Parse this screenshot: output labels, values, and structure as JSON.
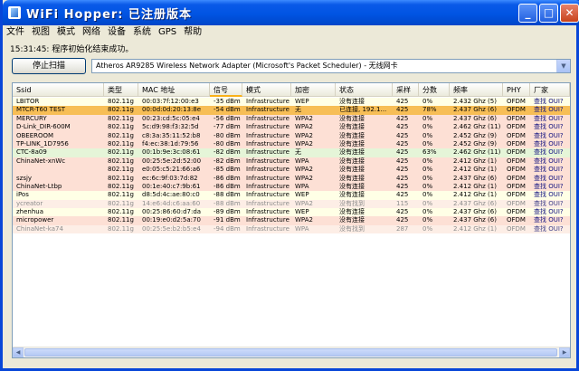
{
  "window": {
    "title": "WiFi Hopper: 已注册版本"
  },
  "menu": [
    "文件",
    "视图",
    "模式",
    "网络",
    "设备",
    "系统",
    "GPS",
    "帮助"
  ],
  "status_text": "15:31:45: 程序初始化结束成功。",
  "toolbar": {
    "stop_scan_label": "停止扫描",
    "adapter_value": "Atheros AR9285 Wireless Network Adapter (Microsoft's Packet Scheduler) - 无线网卡"
  },
  "columns": [
    "Ssid",
    "类型",
    "MAC 地址",
    "信号",
    "模式",
    "加密",
    "状态",
    "采样",
    "分数",
    "频率",
    "PHY",
    "厂家"
  ],
  "sorted_column": "信号",
  "rows": [
    {
      "bg": "#ffffe6",
      "dim": false,
      "cells": [
        "LBITOR",
        "802.11g",
        "00:03:7f:12:00:e3",
        "-35 dBm",
        "Infrastructure",
        "WEP",
        "没有连接",
        "425",
        "0%",
        "2.432 Ghz (5)",
        "OFDM",
        "查找 OUI?"
      ]
    },
    {
      "bg": "#f7be56",
      "dim": false,
      "cells": [
        "MTCR-T60 TEST",
        "802.11g",
        "00:0d:0d:20:13:8e",
        "-54 dBm",
        "Infrastructure",
        "无",
        "已连接, 192.1...",
        "425",
        "78%",
        "2.437 Ghz (6)",
        "OFDM",
        "查找 OUI?"
      ]
    },
    {
      "bg": "#fde0d5",
      "dim": false,
      "cells": [
        "MERCURY",
        "802.11g",
        "00:23:cd:5c:05:e4",
        "-56 dBm",
        "Infrastructure",
        "WPA2",
        "没有连接",
        "425",
        "0%",
        "2.437 Ghz (6)",
        "OFDM",
        "查找 OUI?"
      ]
    },
    {
      "bg": "#fde0d5",
      "dim": false,
      "cells": [
        "D-Link_DIR-600M",
        "802.11g",
        "5c:d9:98:f3:32:5d",
        "-77 dBm",
        "Infrastructure",
        "WPA2",
        "没有连接",
        "425",
        "0%",
        "2.462 Ghz (11)",
        "OFDM",
        "查找 OUI?"
      ]
    },
    {
      "bg": "#fde0d5",
      "dim": false,
      "cells": [
        "OBEEROOM",
        "802.11g",
        "c8:3a:35:11:52:b8",
        "-80 dBm",
        "Infrastructure",
        "WPA2",
        "没有连接",
        "425",
        "0%",
        "2.452 Ghz (9)",
        "OFDM",
        "查找 OUI?"
      ]
    },
    {
      "bg": "#fde0d5",
      "dim": false,
      "cells": [
        "TP-LINK_1D7956",
        "802.11g",
        "f4:ec:38:1d:79:56",
        "-80 dBm",
        "Infrastructure",
        "WPA2",
        "没有连接",
        "425",
        "0%",
        "2.452 Ghz (9)",
        "OFDM",
        "查找 OUI?"
      ]
    },
    {
      "bg": "#e5f5d8",
      "dim": false,
      "cells": [
        "CTC-8a09",
        "802.11g",
        "00:1b:9e:3c:08:61",
        "-82 dBm",
        "Infrastructure",
        "无",
        "没有连接",
        "425",
        "63%",
        "2.462 Ghz (11)",
        "OFDM",
        "查找 OUI?"
      ]
    },
    {
      "bg": "#fde0d5",
      "dim": false,
      "cells": [
        "ChinaNet-xnWc",
        "802.11g",
        "00:25:5e:2d:52:00",
        "-82 dBm",
        "Infrastructure",
        "WPA",
        "没有连接",
        "425",
        "0%",
        "2.412 Ghz (1)",
        "OFDM",
        "查找 OUI?"
      ]
    },
    {
      "bg": "#fde0d5",
      "dim": false,
      "cells": [
        "",
        "802.11g",
        "e0:05:c5:21:66:a6",
        "-85 dBm",
        "Infrastructure",
        "WPA2",
        "没有连接",
        "425",
        "0%",
        "2.412 Ghz (1)",
        "OFDM",
        "查找 OUI?"
      ]
    },
    {
      "bg": "#fde0d5",
      "dim": false,
      "cells": [
        "szsjy",
        "802.11g",
        "ec:6c:9f:03:7d:82",
        "-86 dBm",
        "Infrastructure",
        "WPA2",
        "没有连接",
        "425",
        "0%",
        "2.437 Ghz (6)",
        "OFDM",
        "查找 OUI?"
      ]
    },
    {
      "bg": "#fde0d5",
      "dim": false,
      "cells": [
        "ChinaNet-Ltbp",
        "802.11g",
        "00:1e:40:c7:9b:61",
        "-86 dBm",
        "Infrastructure",
        "WPA",
        "没有连接",
        "425",
        "0%",
        "2.412 Ghz (1)",
        "OFDM",
        "查找 OUI?"
      ]
    },
    {
      "bg": "#ffffe6",
      "dim": false,
      "cells": [
        "iPos",
        "802.11g",
        "d8:5d:4c:ae:80:c0",
        "-88 dBm",
        "Infrastructure",
        "WEP",
        "没有连接",
        "425",
        "0%",
        "2.412 Ghz (1)",
        "OFDM",
        "查找 OUI?"
      ]
    },
    {
      "bg": "#fdeee6",
      "dim": true,
      "cells": [
        "ycreator",
        "802.11g",
        "14:e6:4d:c6:aa:60",
        "-88 dBm",
        "Infrastructure",
        "WPA2",
        "没有找到",
        "115",
        "0%",
        "2.437 Ghz (6)",
        "OFDM",
        "查找 OUI?"
      ]
    },
    {
      "bg": "#ffffe6",
      "dim": false,
      "cells": [
        "zhenhua",
        "802.11g",
        "00:25:86:60:d7:da",
        "-89 dBm",
        "Infrastructure",
        "WEP",
        "没有连接",
        "425",
        "0%",
        "2.437 Ghz (6)",
        "OFDM",
        "查找 OUI?"
      ]
    },
    {
      "bg": "#fde0d5",
      "dim": false,
      "cells": [
        "micropower",
        "802.11g",
        "00:19:e0:d2:5a:70",
        "-91 dBm",
        "Infrastructure",
        "WPA2",
        "没有连接",
        "425",
        "0%",
        "2.437 Ghz (6)",
        "OFDM",
        "查找 OUI?"
      ]
    },
    {
      "bg": "#fdeee6",
      "dim": true,
      "cells": [
        "ChinaNet-ka74",
        "802.11g",
        "00:25:5e:b2:b5:e4",
        "-94 dBm",
        "Infrastructure",
        "WPA",
        "没有找到",
        "287",
        "0%",
        "2.412 Ghz (1)",
        "OFDM",
        "查找 OUI?"
      ]
    }
  ]
}
